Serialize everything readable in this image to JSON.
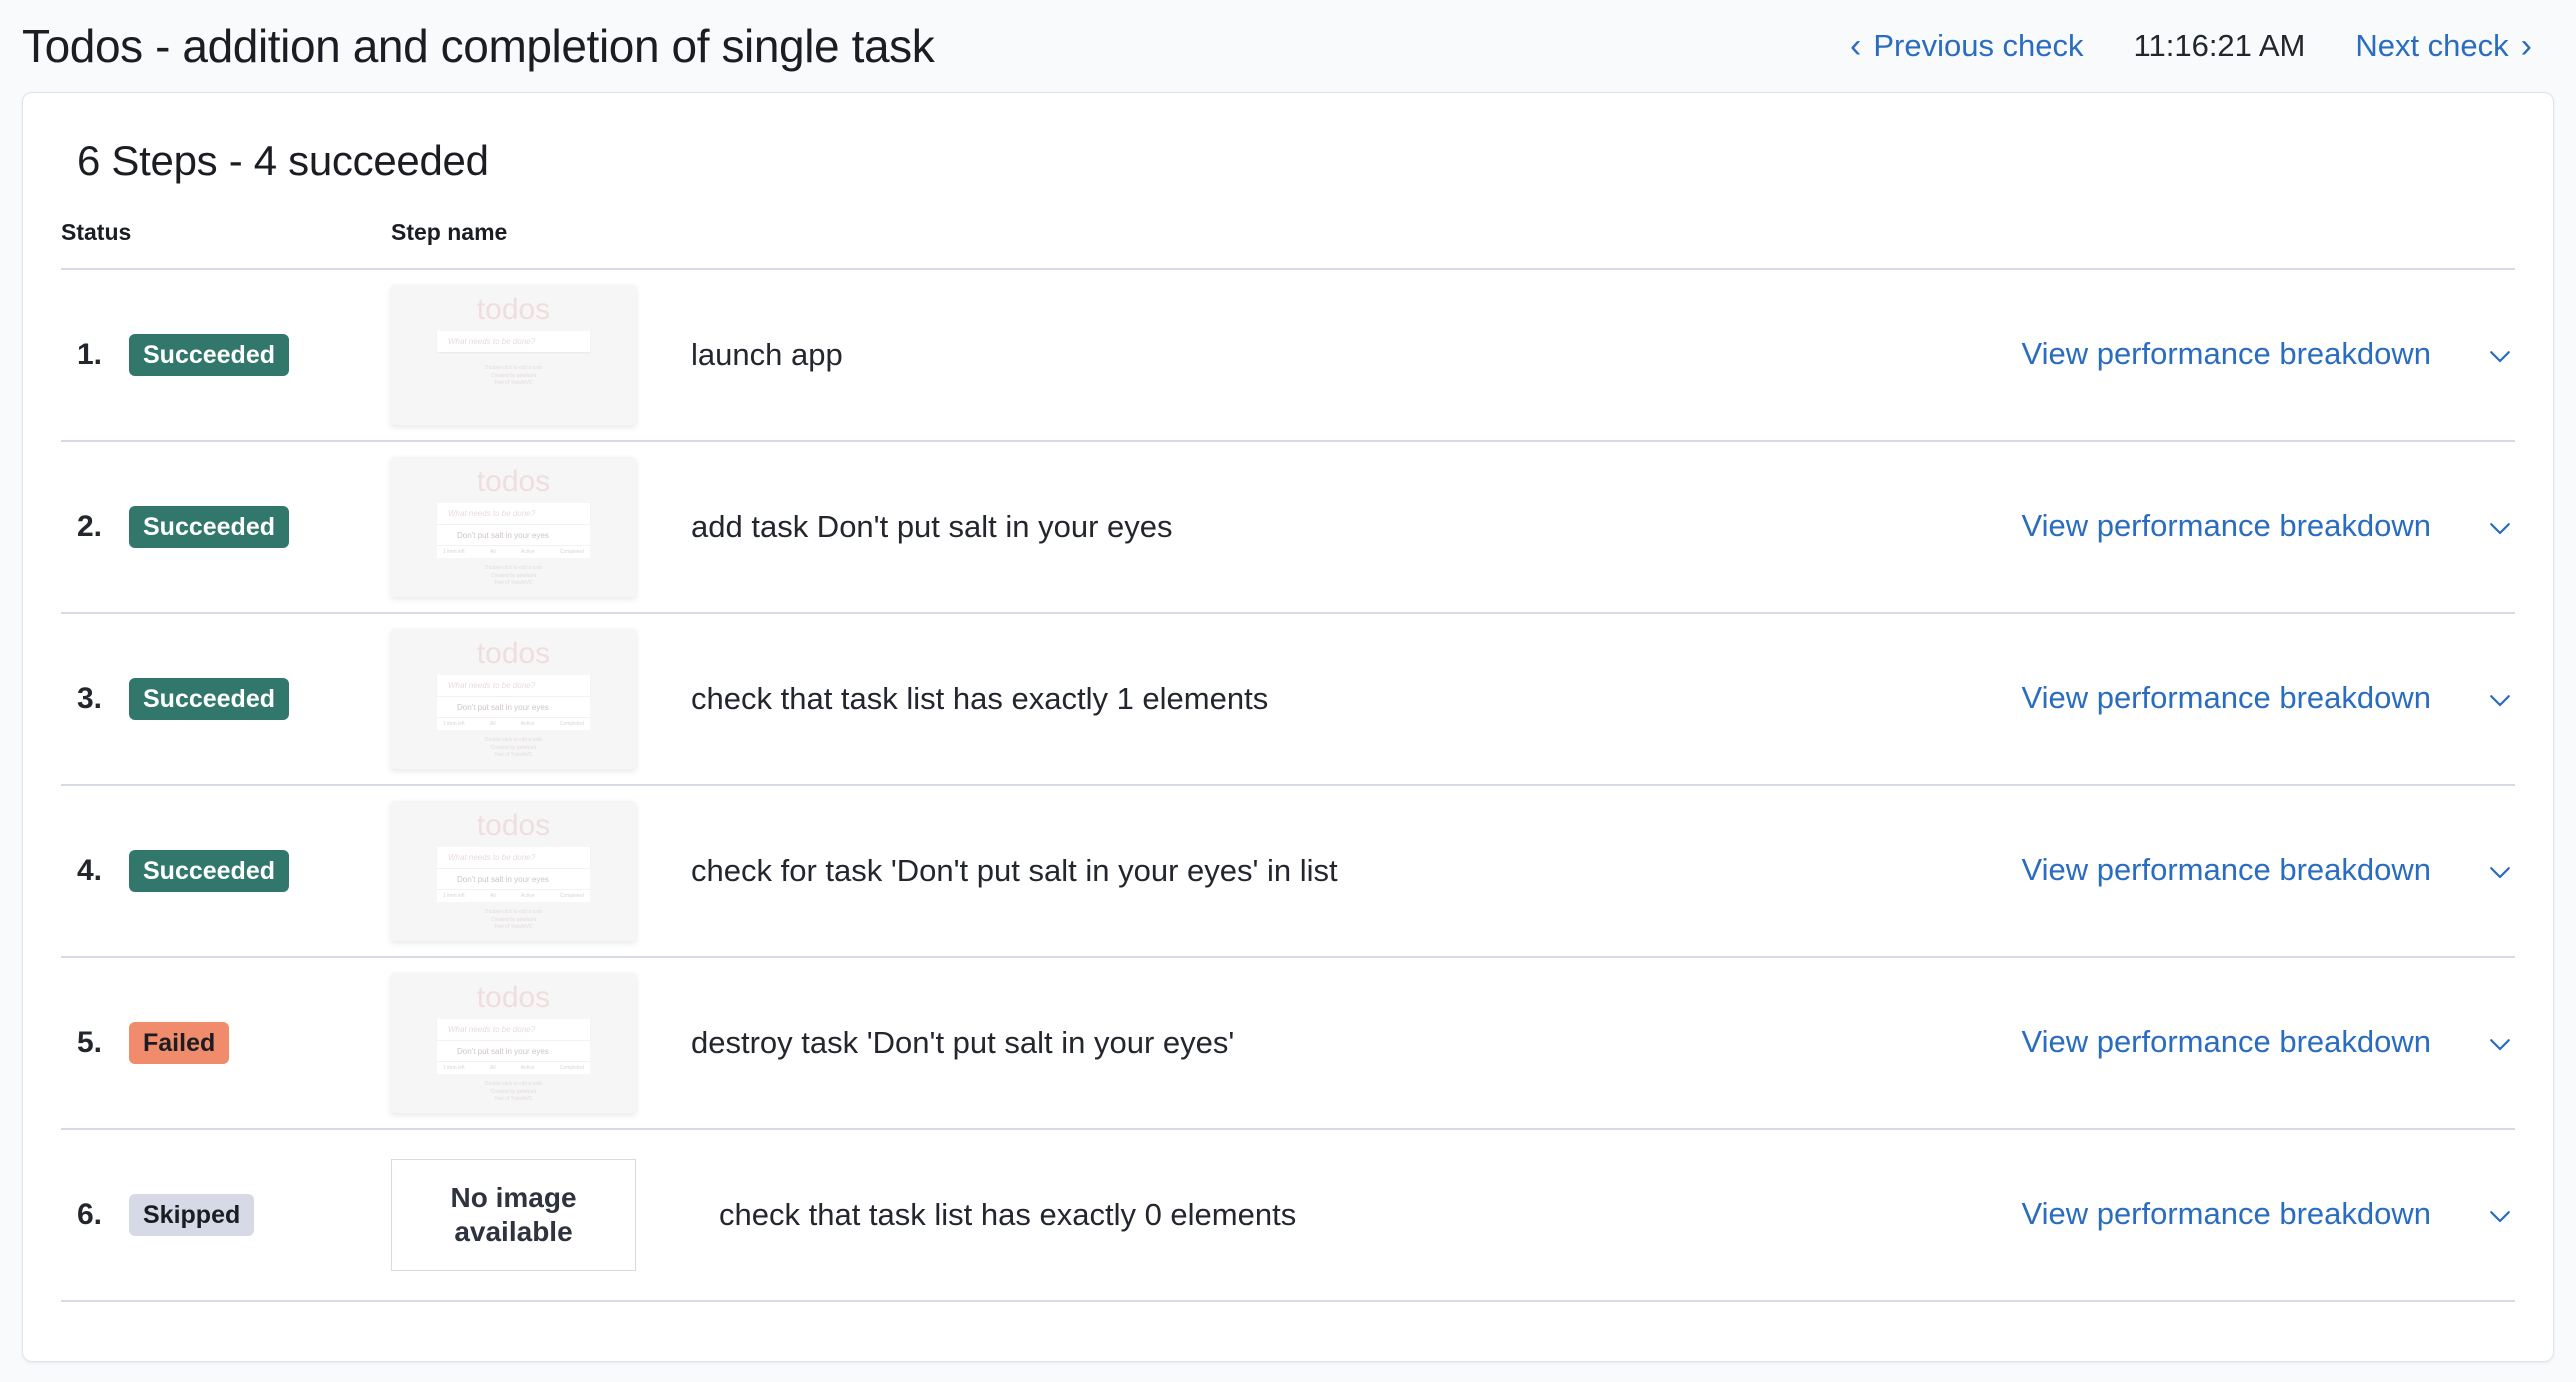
{
  "header": {
    "title": "Todos - addition and completion of single task",
    "prev_label": "Previous check",
    "time": "11:16:21 AM",
    "next_label": "Next check",
    "prev_chevron": "‹",
    "next_chevron": "›"
  },
  "card": {
    "title": "6 Steps - 4 succeeded",
    "columns": {
      "status": "Status",
      "step_name": "Step name"
    },
    "action_label": "View performance breakdown",
    "no_image_line1": "No image",
    "no_image_line2": "available"
  },
  "thumbnail_text": {
    "app_title": "todos",
    "input_placeholder": "What needs to be done?",
    "task_text": "Don't put salt in your eyes",
    "footer_count": "1 item left",
    "filter_all": "All",
    "filter_active": "Active",
    "filter_completed": "Completed",
    "credit1": "Double-click to edit a todo",
    "credit2": "Created by petehunt",
    "credit3": "Part of TodoMVC"
  },
  "colors": {
    "succeeded": "#31776b",
    "failed": "#f08b6c",
    "skipped": "#d6dae6",
    "link": "#2a6dc0",
    "page_bg": "#f8fafc",
    "card_bg": "#ffffff",
    "border": "#d6dae6"
  },
  "steps": [
    {
      "number": "1.",
      "status": "Succeeded",
      "status_class": "succeeded",
      "name": "launch app",
      "thumb": "empty-list",
      "action": "View performance breakdown"
    },
    {
      "number": "2.",
      "status": "Succeeded",
      "status_class": "succeeded",
      "name": "add task Don't put salt in your eyes",
      "thumb": "one-task",
      "action": "View performance breakdown"
    },
    {
      "number": "3.",
      "status": "Succeeded",
      "status_class": "succeeded",
      "name": "check that task list has exactly 1 elements",
      "thumb": "one-task",
      "action": "View performance breakdown"
    },
    {
      "number": "4.",
      "status": "Succeeded",
      "status_class": "succeeded",
      "name": "check for task 'Don't put salt in your eyes' in list",
      "thumb": "one-task",
      "action": "View performance breakdown"
    },
    {
      "number": "5.",
      "status": "Failed",
      "status_class": "failed",
      "name": "destroy task 'Don't put salt in your eyes'",
      "thumb": "one-task",
      "action": "View performance breakdown"
    },
    {
      "number": "6.",
      "status": "Skipped",
      "status_class": "skipped",
      "name": "check that task list has exactly 0 elements",
      "thumb": "no-image",
      "action": "View performance breakdown"
    }
  ]
}
